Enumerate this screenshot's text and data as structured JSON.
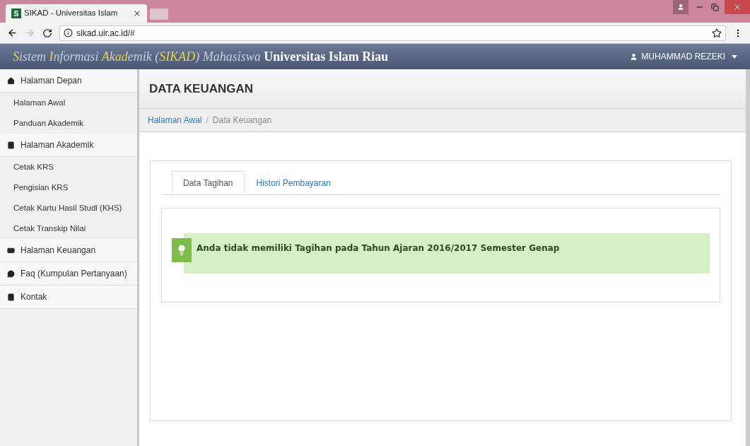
{
  "browser": {
    "tab_title": "SIKAD - Universitas Islam",
    "favicon": "S",
    "url": "sikad.uir.ac.id/#"
  },
  "header": {
    "title_segments": [
      {
        "text": "S",
        "highlight": true
      },
      {
        "text": "istem ",
        "highlight": false
      },
      {
        "text": "I",
        "highlight": true
      },
      {
        "text": "nformasi ",
        "highlight": false
      },
      {
        "text": "A",
        "highlight": true
      },
      {
        "text": "k",
        "highlight": false
      },
      {
        "text": "ad",
        "highlight": true
      },
      {
        "text": "emik (",
        "highlight": false
      },
      {
        "text": "SIKAD",
        "highlight": true
      },
      {
        "text": ") Mahasiswa",
        "highlight": false
      }
    ],
    "title_strong": "Universitas Islam Riau",
    "user": "MUHAMMAD REZEKI"
  },
  "sidebar": {
    "items": [
      {
        "kind": "section",
        "label": "Halaman Depan"
      },
      {
        "kind": "link",
        "label": "Halaman Awal"
      },
      {
        "kind": "link",
        "label": "Panduan Akademik"
      },
      {
        "kind": "section",
        "label": "Halaman Akademik"
      },
      {
        "kind": "link",
        "label": "Cetak KRS"
      },
      {
        "kind": "link",
        "label": "Pengisian KRS"
      },
      {
        "kind": "link",
        "label": "Cetak Kartu Hasil Studi (KHS)"
      },
      {
        "kind": "link",
        "label": "Cetak Transkip Nilai"
      },
      {
        "kind": "section",
        "label": "Halaman Keuangan"
      },
      {
        "kind": "section",
        "label": "Faq (Kumpulan Pertanyaan)"
      },
      {
        "kind": "section",
        "label": "Kontak"
      }
    ]
  },
  "page": {
    "title": "DATA KEUANGAN",
    "breadcrumb": [
      "Halaman Awal",
      "Data Keuangan"
    ],
    "breadcrumb_separator": "/",
    "tabs": [
      {
        "label": "Data Tagihan",
        "selected": true
      },
      {
        "label": "Histori Pembayaran",
        "selected": false
      }
    ],
    "alert": "Anda tidak memiliki Tagihan pada Tahun Ajaran 2016/2017 Semester Genap"
  }
}
